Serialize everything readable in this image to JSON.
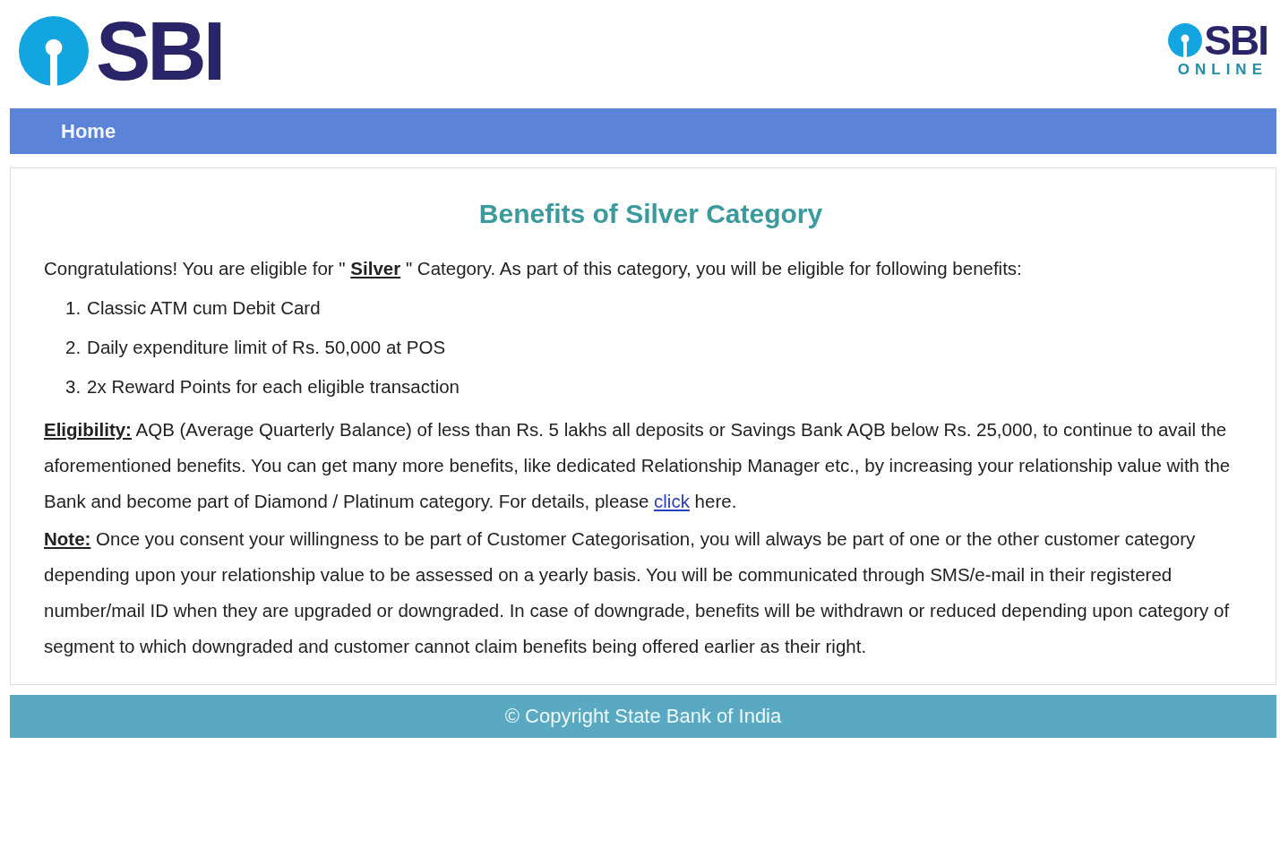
{
  "header": {
    "logo_text": "SBI",
    "online_logo_text": "SBI",
    "online_logo_subtext": "ONLINE"
  },
  "nav": {
    "items": [
      {
        "label": "Home"
      }
    ]
  },
  "content": {
    "title": "Benefits of Silver Category",
    "intro": "Congratulations! You are eligible for \" **Silver** \" Category. As part of this category, you will be eligible for following benefits:",
    "benefits": [
      {
        "number": "1.",
        "text": "Classic ATM cum Debit Card"
      },
      {
        "number": "2.",
        "text": "Daily expenditure limit of Rs. 50,000 at POS"
      },
      {
        "number": "3.",
        "text": "2x Reward Points for each eligible transaction"
      }
    ],
    "eligibility": {
      "text": "**Eligibility:** AQB (Average Quarterly Balance) of less than Rs. 5 lakhs all deposits or Savings Bank AQB below Rs. 25,000, to continue to avail the aforementioned benefits. You can get many more benefits, like dedicated Relationship Manager etc., by increasing your relationship value with the Bank and become part of Diamond / Platinum category. For details, please",
      "link": "click",
      "after": "here."
    },
    "note": "**Note:** Once you consent your willingness to be part of Customer Categorisation, you will always be part of one or the other customer category depending upon your relationship value to be assessed on a yearly basis. You will be communicated through SMS/e-mail in their registered number/mail ID when they are upgraded or downgraded. In case of downgrade, benefits will be withdrawn or reduced depending upon category of segment to which downgraded and customer cannot claim benefits being offered earlier as their right."
  },
  "footer": {
    "text": "© Copyright State Bank of India"
  }
}
